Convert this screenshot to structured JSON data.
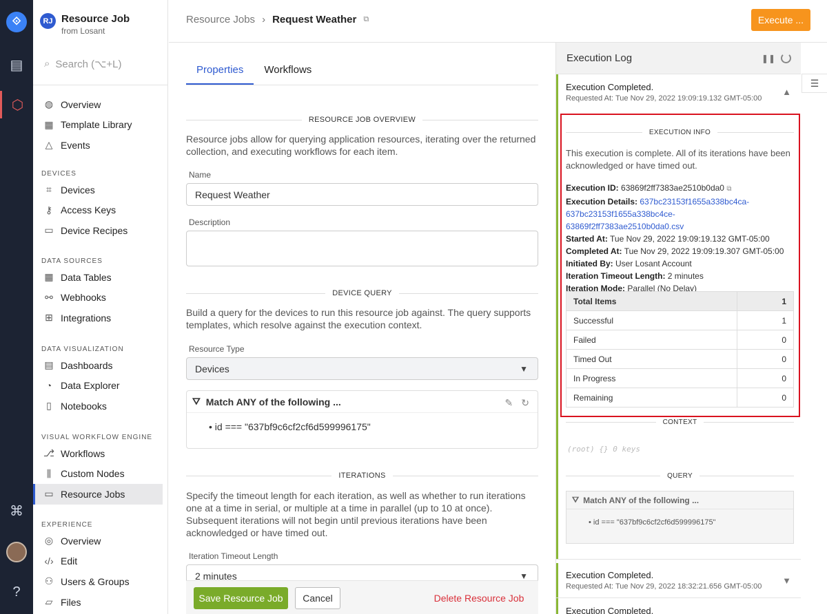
{
  "app": {
    "badge": "RJ",
    "title": "Resource Job",
    "subtitle": "from Losant"
  },
  "search": {
    "placeholder": "Search (⌥+L)"
  },
  "nav": {
    "top": [
      {
        "label": "Overview",
        "icon": "overview-icon"
      },
      {
        "label": "Template Library",
        "icon": "template-library-icon"
      },
      {
        "label": "Events",
        "icon": "events-icon"
      }
    ],
    "devices": {
      "heading": "DEVICES",
      "items": [
        {
          "label": "Devices",
          "icon": "devices-icon"
        },
        {
          "label": "Access Keys",
          "icon": "access-keys-icon"
        },
        {
          "label": "Device Recipes",
          "icon": "device-recipes-icon"
        }
      ]
    },
    "data_sources": {
      "heading": "DATA SOURCES",
      "items": [
        {
          "label": "Data Tables",
          "icon": "data-tables-icon"
        },
        {
          "label": "Webhooks",
          "icon": "webhooks-icon"
        },
        {
          "label": "Integrations",
          "icon": "integrations-icon"
        }
      ]
    },
    "data_visualization": {
      "heading": "DATA VISUALIZATION",
      "items": [
        {
          "label": "Dashboards",
          "icon": "dashboards-icon"
        },
        {
          "label": "Data Explorer",
          "icon": "data-explorer-icon"
        },
        {
          "label": "Notebooks",
          "icon": "notebooks-icon"
        }
      ]
    },
    "workflow_engine": {
      "heading": "VISUAL WORKFLOW ENGINE",
      "items": [
        {
          "label": "Workflows",
          "icon": "workflows-icon"
        },
        {
          "label": "Custom Nodes",
          "icon": "custom-nodes-icon"
        },
        {
          "label": "Resource Jobs",
          "icon": "resource-jobs-icon"
        }
      ]
    },
    "experience": {
      "heading": "EXPERIENCE",
      "items": [
        {
          "label": "Overview",
          "icon": "experience-overview-icon"
        },
        {
          "label": "Edit",
          "icon": "edit-icon"
        },
        {
          "label": "Users & Groups",
          "icon": "users-groups-icon"
        },
        {
          "label": "Files",
          "icon": "files-icon"
        }
      ]
    }
  },
  "breadcrumb": {
    "parent": "Resource Jobs",
    "separator": "›",
    "current": "Request Weather"
  },
  "header": {
    "execute_label": "Execute ..."
  },
  "tabs": {
    "properties": "Properties",
    "workflows": "Workflows"
  },
  "overview": {
    "title": "RESOURCE JOB OVERVIEW",
    "description": "Resource jobs allow for querying application resources, iterating over the returned collection, and executing workflows for each item.",
    "name_label": "Name",
    "name_value": "Request Weather",
    "description_label": "Description",
    "description_value": ""
  },
  "device_query": {
    "title": "DEVICE QUERY",
    "description": "Build a query for the devices to run this resource job against. The query supports templates, which resolve against the execution context.",
    "resource_type_label": "Resource Type",
    "resource_type_value": "Devices",
    "match_label": "Match ANY of the following ...",
    "condition": "id === \"637bf9c6cf2cf6d599996175\""
  },
  "iterations": {
    "title": "ITERATIONS",
    "description": "Specify the timeout length for each iteration, as well as whether to run iterations one at a time in serial, or multiple at a time in parallel (up to 10 at once). Subsequent iterations will not begin until previous iterations have been acknowledged or have timed out.",
    "timeout_label": "Iteration Timeout Length",
    "timeout_value": "2 minutes"
  },
  "actions": {
    "save": "Save Resource Job",
    "cancel": "Cancel",
    "delete": "Delete Resource Job"
  },
  "execution_log": {
    "title": "Execution Log",
    "entries": [
      {
        "title": "Execution Completed.",
        "requested": "Requested At: Tue Nov 29, 2022 19:09:19.132 GMT-05:00"
      },
      {
        "title": "Execution Completed.",
        "requested": "Requested At: Tue Nov 29, 2022 18:32:21.656 GMT-05:00"
      },
      {
        "title": "Execution Completed."
      }
    ],
    "info": {
      "section_title": "EXECUTION INFO",
      "summary": "This execution is complete. All of its iterations have been acknowledged or have timed out.",
      "execution_id_label": "Execution ID:",
      "execution_id": "63869f2ff7383ae2510b0da0",
      "details_label": "Execution Details:",
      "details_link_1": "637bc23153f1655a338bc4ca-",
      "details_link_2": "637bc23153f1655a338bc4ce-63869f2ff7383ae2510b0da0.csv",
      "started_label": "Started At:",
      "started": "Tue Nov 29, 2022 19:09:19.132 GMT-05:00",
      "completed_label": "Completed At:",
      "completed": "Tue Nov 29, 2022 19:09:19.307 GMT-05:00",
      "initiated_label": "Initiated By:",
      "initiated": "User Losant Account",
      "timeout_label": "Iteration Timeout Length:",
      "timeout": "2 minutes",
      "mode_label": "Iteration Mode:",
      "mode": "Parallel (No Delay)"
    },
    "stats": [
      {
        "label": "Total Items",
        "value": "1"
      },
      {
        "label": "Successful",
        "value": "1"
      },
      {
        "label": "Failed",
        "value": "0"
      },
      {
        "label": "Timed Out",
        "value": "0"
      },
      {
        "label": "In Progress",
        "value": "0"
      },
      {
        "label": "Remaining",
        "value": "0"
      }
    ],
    "context": {
      "title": "CONTEXT",
      "value": "(root)  {}  0 keys"
    },
    "query": {
      "title": "QUERY",
      "match_label": "Match ANY of the following ...",
      "condition": "id === \"637bf9c6cf2cf6d599996175\""
    }
  },
  "colors": {
    "accent": "#2f5bd0",
    "execute": "#f7941d",
    "save": "#7aab2a",
    "delete": "#d9303a",
    "highlight": "#d9121f"
  }
}
